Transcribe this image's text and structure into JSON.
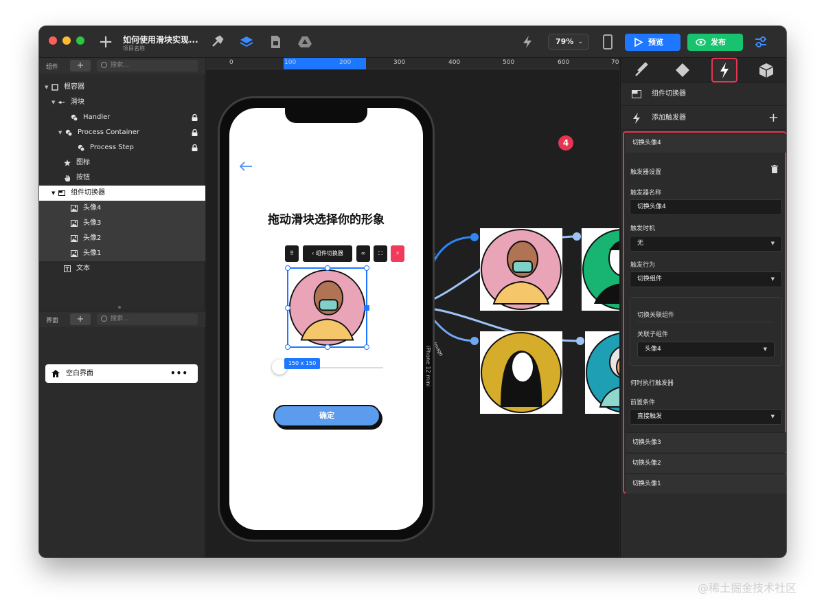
{
  "titlebar": {
    "doc_title": "如何使用滑块实现...",
    "doc_subtitle": "项目名称",
    "zoom": "79%",
    "preview_label": "预览",
    "publish_label": "发布"
  },
  "colors": {
    "accent_blue": "#1e78ff",
    "publish_green": "#17c36e",
    "highlight_red": "#e5364f"
  },
  "left_panel": {
    "components_label": "组件",
    "search_placeholder": "搜索...",
    "tree": [
      {
        "label": "根容器",
        "icon": "square-icon"
      },
      {
        "label": "滑块",
        "icon": "slider-icon"
      },
      {
        "label": "Handler",
        "icon": "group-icon",
        "locked": true
      },
      {
        "label": "Process Container",
        "icon": "group-icon",
        "locked": true
      },
      {
        "label": "Process Step",
        "icon": "group-icon",
        "locked": true
      },
      {
        "label": "图标",
        "icon": "star-icon"
      },
      {
        "label": "按钮",
        "icon": "hand-icon"
      },
      {
        "label": "组件切换器",
        "icon": "switcher-icon"
      },
      {
        "label": "头像4",
        "icon": "image-icon"
      },
      {
        "label": "头像3",
        "icon": "image-icon"
      },
      {
        "label": "头像2",
        "icon": "image-icon"
      },
      {
        "label": "头像1",
        "icon": "image-icon"
      },
      {
        "label": "文本",
        "icon": "text-icon"
      }
    ],
    "pages_label": "界面",
    "pages_search_placeholder": "搜索...",
    "page_item": "空白界面",
    "page_more": "•••"
  },
  "canvas": {
    "ruler_ticks": [
      "0",
      "100",
      "200",
      "300",
      "400",
      "500",
      "600",
      "70"
    ],
    "screen_heading": "拖动滑块选择你的形象",
    "toolbar_switcher": "组件切换器",
    "size_badge": "150 x 150",
    "confirm_button": "确定",
    "device_label": "iPhone 12 mini",
    "connection_label": "Image"
  },
  "right_panel": {
    "component_name": "组件切换器",
    "add_trigger": "添加触发器",
    "trigger_title": "切换头像4",
    "step_badge": "4",
    "trigger_settings": "触发器设置",
    "trigger_name_label": "触发器名称",
    "trigger_name_value": "切换头像4",
    "trigger_timing_label": "触发时机",
    "trigger_timing_value": "无",
    "trigger_action_label": "触发行为",
    "trigger_action_value": "切换组件",
    "switch_related_label": "切换关联组件",
    "child_label": "关联子组件",
    "child_value": "头像4",
    "when_label": "何时执行触发器",
    "precondition_label": "前置条件",
    "precondition_value": "直接触发",
    "other_triggers": [
      "切换头像3",
      "切换头像2",
      "切换头像1"
    ]
  },
  "watermark": "@稀土掘金技术社区"
}
